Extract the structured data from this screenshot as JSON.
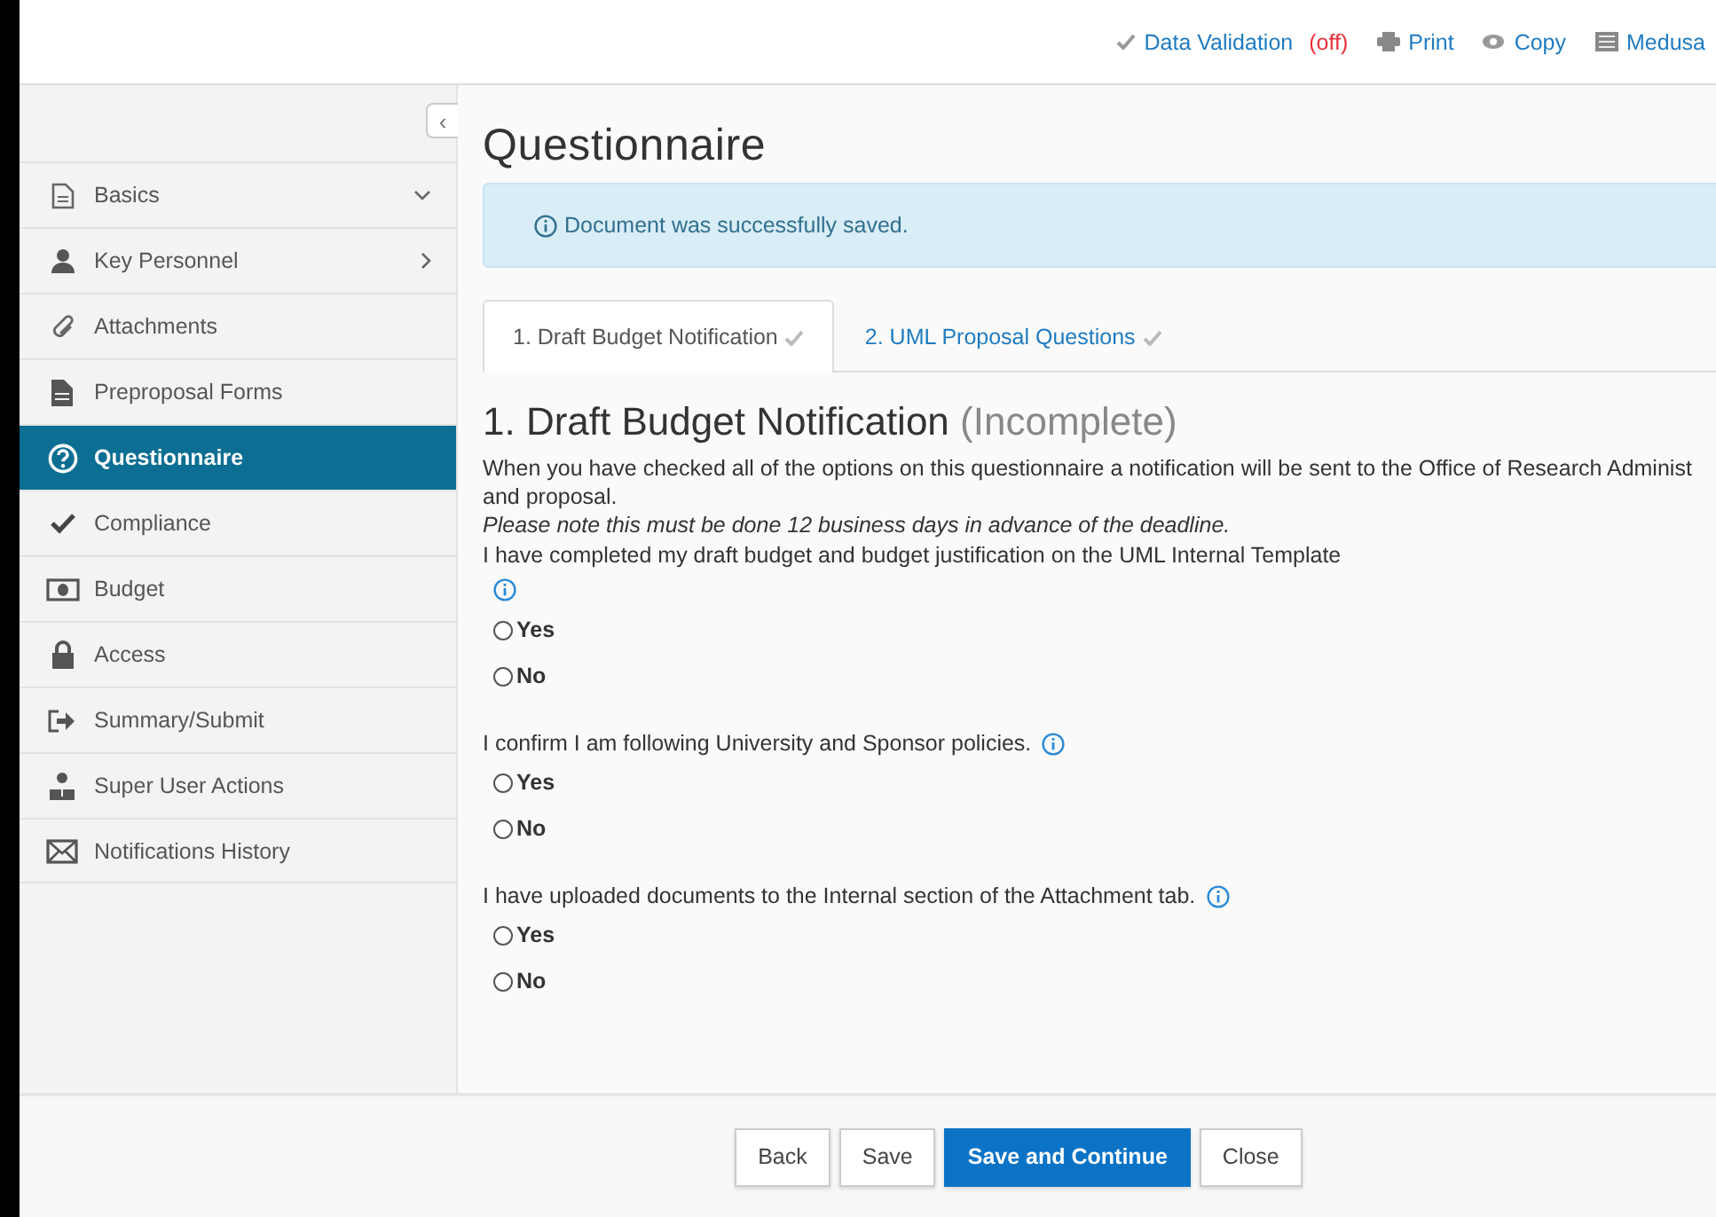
{
  "top_links": [
    {
      "label": "Data Validation",
      "status": "(off)"
    },
    {
      "label": "Print"
    },
    {
      "label": "Copy"
    },
    {
      "label": "Medusa"
    }
  ],
  "sidebar": {
    "collapse": "‹",
    "items": [
      {
        "label": "Basics",
        "expanded": true,
        "selected": false
      },
      {
        "label": "Key Personnel",
        "expanded": false,
        "selected": false
      },
      {
        "label": "Attachments",
        "selected": false
      },
      {
        "label": "Preproposal Forms",
        "selected": false
      },
      {
        "label": "Questionnaire",
        "selected": true
      },
      {
        "label": "Compliance",
        "selected": false
      },
      {
        "label": "Budget",
        "selected": false
      },
      {
        "label": "Access",
        "selected": false
      },
      {
        "label": "Summary/Submit",
        "selected": false
      },
      {
        "label": "Super User Actions",
        "selected": false
      },
      {
        "label": "Notifications History",
        "selected": false
      }
    ]
  },
  "page_title": "Questionnaire",
  "alert": "Document was successfully saved.",
  "tabs": [
    {
      "label": "1. Draft Budget Notification",
      "selected": true,
      "complete": true
    },
    {
      "label": "2. UML Proposal Questions",
      "selected": false,
      "complete": true
    }
  ],
  "section": {
    "number": "1.",
    "title": "Draft Budget Notification",
    "status": "(Incomplete)",
    "intro": "When you have checked all of the options on this questionnaire a notification will be sent to the Office of Research Administ\nand proposal.",
    "note": "Please note this must be done 12 business days in advance of the deadline.",
    "questions": [
      {
        "text": "I have completed my draft budget and budget justification on the UML Internal Template",
        "info_below": true,
        "options": [
          {
            "label": "Yes",
            "selected": false
          },
          {
            "label": "No",
            "selected": false
          }
        ]
      },
      {
        "text": "I confirm I am following University and Sponsor policies.",
        "info_below": false,
        "options": [
          {
            "label": "Yes",
            "selected": false
          },
          {
            "label": "No",
            "selected": false
          }
        ]
      },
      {
        "text": "I have uploaded documents to the Internal section of the Attachment tab.",
        "info_below": false,
        "options": [
          {
            "label": "Yes",
            "selected": false
          },
          {
            "label": "No",
            "selected": false
          }
        ]
      }
    ]
  },
  "buttons": [
    {
      "label": "Back",
      "primary": false
    },
    {
      "label": "Save",
      "primary": false
    },
    {
      "label": "Save and Continue",
      "primary": true
    },
    {
      "label": "Close",
      "primary": false
    }
  ]
}
